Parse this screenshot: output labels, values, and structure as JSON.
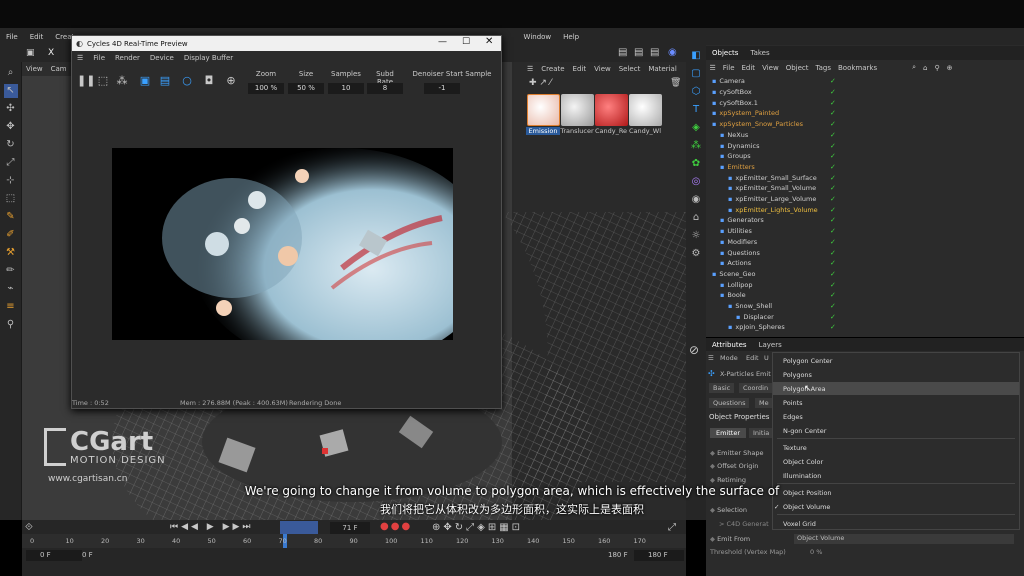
{
  "menubar": {
    "items": [
      "File",
      "Edit",
      "Create",
      "Window",
      "Help"
    ]
  },
  "viewport": {
    "menu": [
      "View",
      "Cam"
    ]
  },
  "render_window": {
    "title": "Cycles 4D Real-Time Preview",
    "menu": [
      "File",
      "Render",
      "Device",
      "Display Buffer"
    ],
    "fields": {
      "zoom_label": "Zoom",
      "zoom": "100 %",
      "size_label": "Size",
      "size": "50 %",
      "samples_label": "Samples",
      "samples": "10",
      "subd_label": "Subd Rate",
      "subd": "8",
      "denoiser_label": "Denoiser Start Sample",
      "denoiser": "-1"
    },
    "time": "Time : 0:52",
    "mem": "Mem : 276.88M (Peak : 400.63M)",
    "status": "Rendering Done"
  },
  "materials": {
    "menu": [
      "Create",
      "Edit",
      "View",
      "Select",
      "Material"
    ],
    "items": [
      {
        "label": "Emission",
        "color": "#e8d0c8"
      },
      {
        "label": "Translucer",
        "color": "#cfcfcf"
      },
      {
        "label": "Candy_Re",
        "color": "#d22828"
      },
      {
        "label": "Candy_Wl",
        "color": "#d8d8d8"
      }
    ]
  },
  "objects": {
    "tabs": [
      "Objects",
      "Takes"
    ],
    "menu": [
      "File",
      "Edit",
      "View",
      "Object",
      "Tags",
      "Bookmarks"
    ],
    "rows": [
      {
        "name": "Camera",
        "indent": 0,
        "color": "#d0d0d0"
      },
      {
        "name": "cySoftBox",
        "indent": 0,
        "color": "#d0d0d0"
      },
      {
        "name": "cySoftBox.1",
        "indent": 0,
        "color": "#d0d0d0"
      },
      {
        "name": "xpSystem_Painted",
        "indent": 0,
        "color": "#e0a040"
      },
      {
        "name": "xpSystem_Snow_Particles",
        "indent": 0,
        "color": "#e0a040"
      },
      {
        "name": "NeXus",
        "indent": 1,
        "color": "#d0d0d0"
      },
      {
        "name": "Dynamics",
        "indent": 1,
        "color": "#d0d0d0"
      },
      {
        "name": "Groups",
        "indent": 1,
        "color": "#d0d0d0"
      },
      {
        "name": "Emitters",
        "indent": 1,
        "color": "#e0a040"
      },
      {
        "name": "xpEmitter_Small_Surface",
        "indent": 2,
        "color": "#d0d0d0"
      },
      {
        "name": "xpEmitter_Small_Volume",
        "indent": 2,
        "color": "#d0d0d0"
      },
      {
        "name": "xpEmitter_Large_Volume",
        "indent": 2,
        "color": "#d0d0d0"
      },
      {
        "name": "xpEmitter_Lights_Volume",
        "indent": 2,
        "color": "#f0c040"
      },
      {
        "name": "Generators",
        "indent": 1,
        "color": "#d0d0d0"
      },
      {
        "name": "Utilities",
        "indent": 1,
        "color": "#d0d0d0"
      },
      {
        "name": "Modifiers",
        "indent": 1,
        "color": "#d0d0d0"
      },
      {
        "name": "Questions",
        "indent": 1,
        "color": "#d0d0d0"
      },
      {
        "name": "Actions",
        "indent": 1,
        "color": "#d0d0d0"
      },
      {
        "name": "Scene_Geo",
        "indent": 0,
        "color": "#d0d0d0"
      },
      {
        "name": "Lollipop",
        "indent": 1,
        "color": "#d0d0d0"
      },
      {
        "name": "Boole",
        "indent": 1,
        "color": "#d0d0d0"
      },
      {
        "name": "Snow_Shell",
        "indent": 2,
        "color": "#d0d0d0"
      },
      {
        "name": "Displacer",
        "indent": 3,
        "color": "#d0d0d0"
      },
      {
        "name": "xpJoin_Spheres",
        "indent": 2,
        "color": "#d0d0d0"
      }
    ]
  },
  "attributes": {
    "tabs": [
      "Attributes",
      "Layers"
    ],
    "menu": [
      "Mode",
      "Edit",
      "U"
    ],
    "object": "X-Particles Emit",
    "tabs2": [
      "Basic",
      "Coordin",
      "Questions",
      "Me"
    ],
    "section": "Object Properties",
    "subtabs": [
      "Emitter",
      "Initia"
    ],
    "props": [
      "Emitter Shape",
      "Offset Origin",
      "Retiming",
      "Selection",
      "Emit From"
    ],
    "extra": "Threshold (Vertex Map)",
    "group": "> C4D Generat",
    "emit_from_value": "Object Volume",
    "threshold_value": "0 %"
  },
  "dropdown": {
    "items": [
      "Polygon Center",
      "Polygons",
      "Polygon Area",
      "Points",
      "Edges",
      "N-gon Center",
      "Texture",
      "Object Color",
      "Illumination",
      "Object Position",
      "Object Volume",
      "Voxel Grid"
    ],
    "highlighted": "Polygon Area",
    "checked": "Object Volume"
  },
  "timeline": {
    "ticks": [
      "0",
      "10",
      "20",
      "30",
      "40",
      "50",
      "60",
      "70",
      "80",
      "90",
      "100",
      "110",
      "120",
      "130",
      "140",
      "150",
      "160",
      "170"
    ],
    "frame": "71 F",
    "start": "0 F",
    "start2": "0 F",
    "end": "180 F",
    "end2": "180 F"
  },
  "subtitle": {
    "en": "We're going to change it from volume to polygon area, which is effectively the surface of",
    "zh": "我们将把它从体积改为多边形面积，这实际上是表面积"
  },
  "logo": {
    "brand": "CGart",
    "tag": "MOTION DESIGN",
    "url": "www.cgartisan.cn"
  }
}
